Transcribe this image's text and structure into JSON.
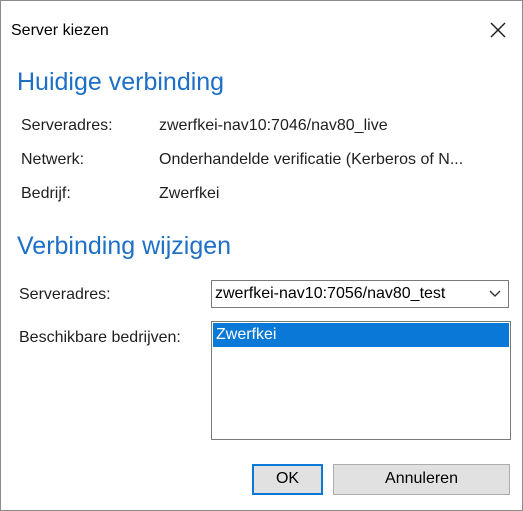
{
  "window": {
    "title": "Server kiezen"
  },
  "current_connection": {
    "heading": "Huidige verbinding",
    "server_label": "Serveradres:",
    "server_value": "zwerfkei-nav10:7046/nav80_live",
    "network_label": "Netwerk:",
    "network_value": "Onderhandelde verificatie (Kerberos of N...",
    "company_label": "Bedrijf:",
    "company_value": "Zwerfkei"
  },
  "change_connection": {
    "heading": "Verbinding wijzigen",
    "server_label": "Serveradres:",
    "server_selected": "zwerfkei-nav10:7056/nav80_test",
    "companies_label": "Beschikbare bedrijven:",
    "companies": [
      "Zwerfkei"
    ]
  },
  "buttons": {
    "ok": "OK",
    "cancel": "Annuleren"
  },
  "icons": {
    "close": "close-icon",
    "dropdown": "chevron-down-icon"
  },
  "colors": {
    "heading": "#1e6fc6",
    "selection": "#0a78d7",
    "button_face": "#e1e1e1"
  }
}
